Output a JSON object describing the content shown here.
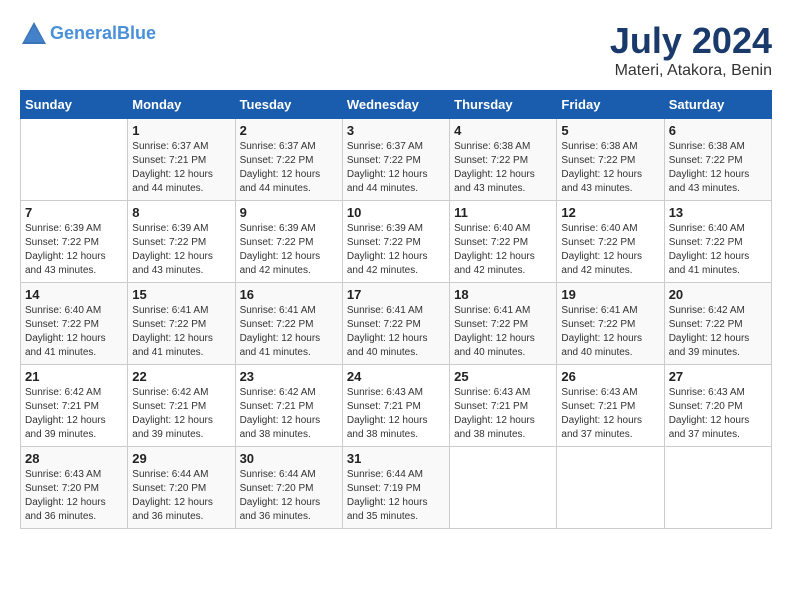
{
  "header": {
    "logo_line1": "General",
    "logo_line2": "Blue",
    "month_year": "July 2024",
    "location": "Materi, Atakora, Benin"
  },
  "days_of_week": [
    "Sunday",
    "Monday",
    "Tuesday",
    "Wednesday",
    "Thursday",
    "Friday",
    "Saturday"
  ],
  "weeks": [
    [
      {
        "day": "",
        "detail": ""
      },
      {
        "day": "1",
        "detail": "Sunrise: 6:37 AM\nSunset: 7:21 PM\nDaylight: 12 hours\nand 44 minutes."
      },
      {
        "day": "2",
        "detail": "Sunrise: 6:37 AM\nSunset: 7:22 PM\nDaylight: 12 hours\nand 44 minutes."
      },
      {
        "day": "3",
        "detail": "Sunrise: 6:37 AM\nSunset: 7:22 PM\nDaylight: 12 hours\nand 44 minutes."
      },
      {
        "day": "4",
        "detail": "Sunrise: 6:38 AM\nSunset: 7:22 PM\nDaylight: 12 hours\nand 43 minutes."
      },
      {
        "day": "5",
        "detail": "Sunrise: 6:38 AM\nSunset: 7:22 PM\nDaylight: 12 hours\nand 43 minutes."
      },
      {
        "day": "6",
        "detail": "Sunrise: 6:38 AM\nSunset: 7:22 PM\nDaylight: 12 hours\nand 43 minutes."
      }
    ],
    [
      {
        "day": "7",
        "detail": "Sunrise: 6:39 AM\nSunset: 7:22 PM\nDaylight: 12 hours\nand 43 minutes."
      },
      {
        "day": "8",
        "detail": "Sunrise: 6:39 AM\nSunset: 7:22 PM\nDaylight: 12 hours\nand 43 minutes."
      },
      {
        "day": "9",
        "detail": "Sunrise: 6:39 AM\nSunset: 7:22 PM\nDaylight: 12 hours\nand 42 minutes."
      },
      {
        "day": "10",
        "detail": "Sunrise: 6:39 AM\nSunset: 7:22 PM\nDaylight: 12 hours\nand 42 minutes."
      },
      {
        "day": "11",
        "detail": "Sunrise: 6:40 AM\nSunset: 7:22 PM\nDaylight: 12 hours\nand 42 minutes."
      },
      {
        "day": "12",
        "detail": "Sunrise: 6:40 AM\nSunset: 7:22 PM\nDaylight: 12 hours\nand 42 minutes."
      },
      {
        "day": "13",
        "detail": "Sunrise: 6:40 AM\nSunset: 7:22 PM\nDaylight: 12 hours\nand 41 minutes."
      }
    ],
    [
      {
        "day": "14",
        "detail": "Sunrise: 6:40 AM\nSunset: 7:22 PM\nDaylight: 12 hours\nand 41 minutes."
      },
      {
        "day": "15",
        "detail": "Sunrise: 6:41 AM\nSunset: 7:22 PM\nDaylight: 12 hours\nand 41 minutes."
      },
      {
        "day": "16",
        "detail": "Sunrise: 6:41 AM\nSunset: 7:22 PM\nDaylight: 12 hours\nand 41 minutes."
      },
      {
        "day": "17",
        "detail": "Sunrise: 6:41 AM\nSunset: 7:22 PM\nDaylight: 12 hours\nand 40 minutes."
      },
      {
        "day": "18",
        "detail": "Sunrise: 6:41 AM\nSunset: 7:22 PM\nDaylight: 12 hours\nand 40 minutes."
      },
      {
        "day": "19",
        "detail": "Sunrise: 6:41 AM\nSunset: 7:22 PM\nDaylight: 12 hours\nand 40 minutes."
      },
      {
        "day": "20",
        "detail": "Sunrise: 6:42 AM\nSunset: 7:22 PM\nDaylight: 12 hours\nand 39 minutes."
      }
    ],
    [
      {
        "day": "21",
        "detail": "Sunrise: 6:42 AM\nSunset: 7:21 PM\nDaylight: 12 hours\nand 39 minutes."
      },
      {
        "day": "22",
        "detail": "Sunrise: 6:42 AM\nSunset: 7:21 PM\nDaylight: 12 hours\nand 39 minutes."
      },
      {
        "day": "23",
        "detail": "Sunrise: 6:42 AM\nSunset: 7:21 PM\nDaylight: 12 hours\nand 38 minutes."
      },
      {
        "day": "24",
        "detail": "Sunrise: 6:43 AM\nSunset: 7:21 PM\nDaylight: 12 hours\nand 38 minutes."
      },
      {
        "day": "25",
        "detail": "Sunrise: 6:43 AM\nSunset: 7:21 PM\nDaylight: 12 hours\nand 38 minutes."
      },
      {
        "day": "26",
        "detail": "Sunrise: 6:43 AM\nSunset: 7:21 PM\nDaylight: 12 hours\nand 37 minutes."
      },
      {
        "day": "27",
        "detail": "Sunrise: 6:43 AM\nSunset: 7:20 PM\nDaylight: 12 hours\nand 37 minutes."
      }
    ],
    [
      {
        "day": "28",
        "detail": "Sunrise: 6:43 AM\nSunset: 7:20 PM\nDaylight: 12 hours\nand 36 minutes."
      },
      {
        "day": "29",
        "detail": "Sunrise: 6:44 AM\nSunset: 7:20 PM\nDaylight: 12 hours\nand 36 minutes."
      },
      {
        "day": "30",
        "detail": "Sunrise: 6:44 AM\nSunset: 7:20 PM\nDaylight: 12 hours\nand 36 minutes."
      },
      {
        "day": "31",
        "detail": "Sunrise: 6:44 AM\nSunset: 7:19 PM\nDaylight: 12 hours\nand 35 minutes."
      },
      {
        "day": "",
        "detail": ""
      },
      {
        "day": "",
        "detail": ""
      },
      {
        "day": "",
        "detail": ""
      }
    ]
  ]
}
